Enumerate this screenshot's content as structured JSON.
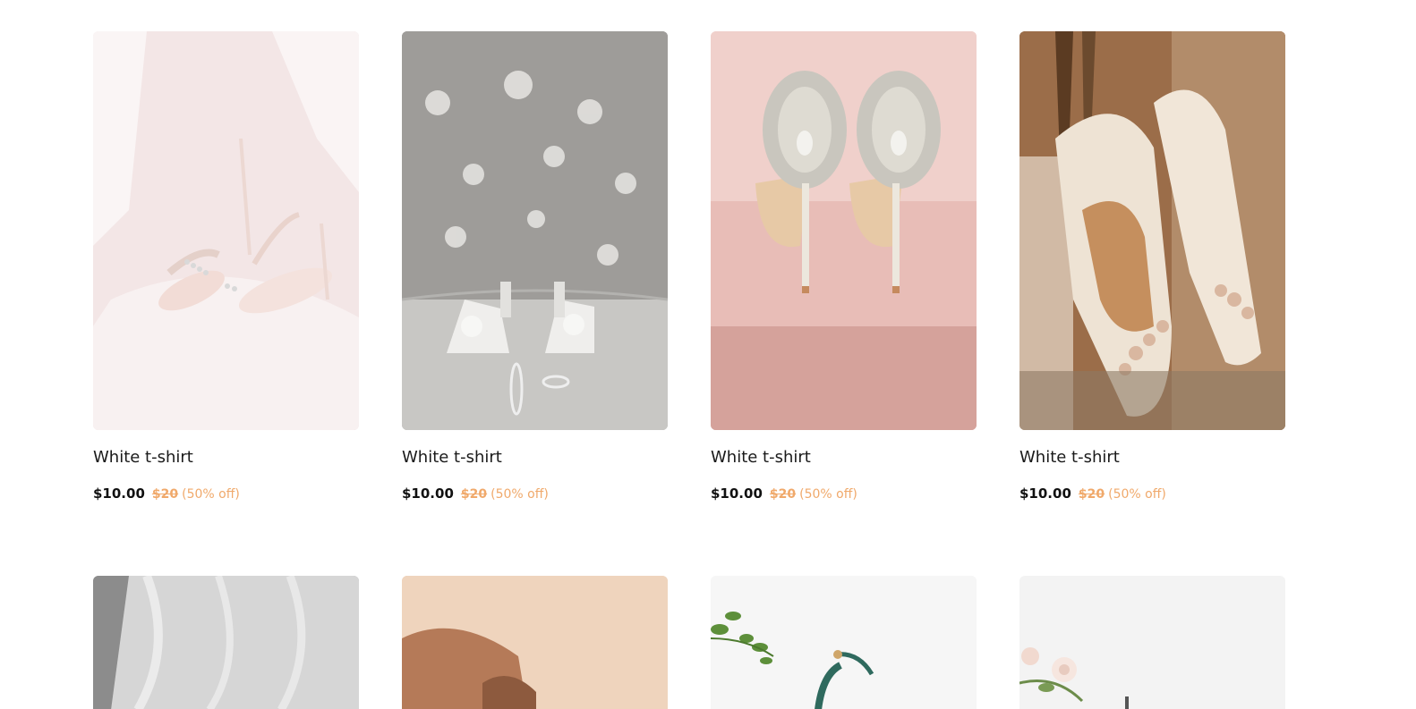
{
  "products_row1": [
    {
      "title": "White t-shirt",
      "price": "$10.00",
      "old_price": "$20",
      "discount": "(50% off)",
      "image": "strappy-heel-sandals-photo"
    },
    {
      "title": "White t-shirt",
      "price": "$10.00",
      "old_price": "$20",
      "discount": "(50% off)",
      "image": "pearl-bow-block-heels-photo"
    },
    {
      "title": "White t-shirt",
      "price": "$10.00",
      "old_price": "$20",
      "discount": "(50% off)",
      "image": "jeweled-stiletto-heels-photo"
    },
    {
      "title": "White t-shirt",
      "price": "$10.00",
      "old_price": "$20",
      "discount": "(50% off)",
      "image": "slingback-pumps-photo"
    }
  ],
  "products_row2": [
    {
      "image": "bridal-veil-photo"
    },
    {
      "image": "beige-leg-heel-photo"
    },
    {
      "image": "green-sandal-flowers-photo"
    },
    {
      "image": "white-flowers-heel-photo"
    }
  ],
  "colors": {
    "discount_accent": "#f0a96b",
    "price_text": "#111111"
  }
}
